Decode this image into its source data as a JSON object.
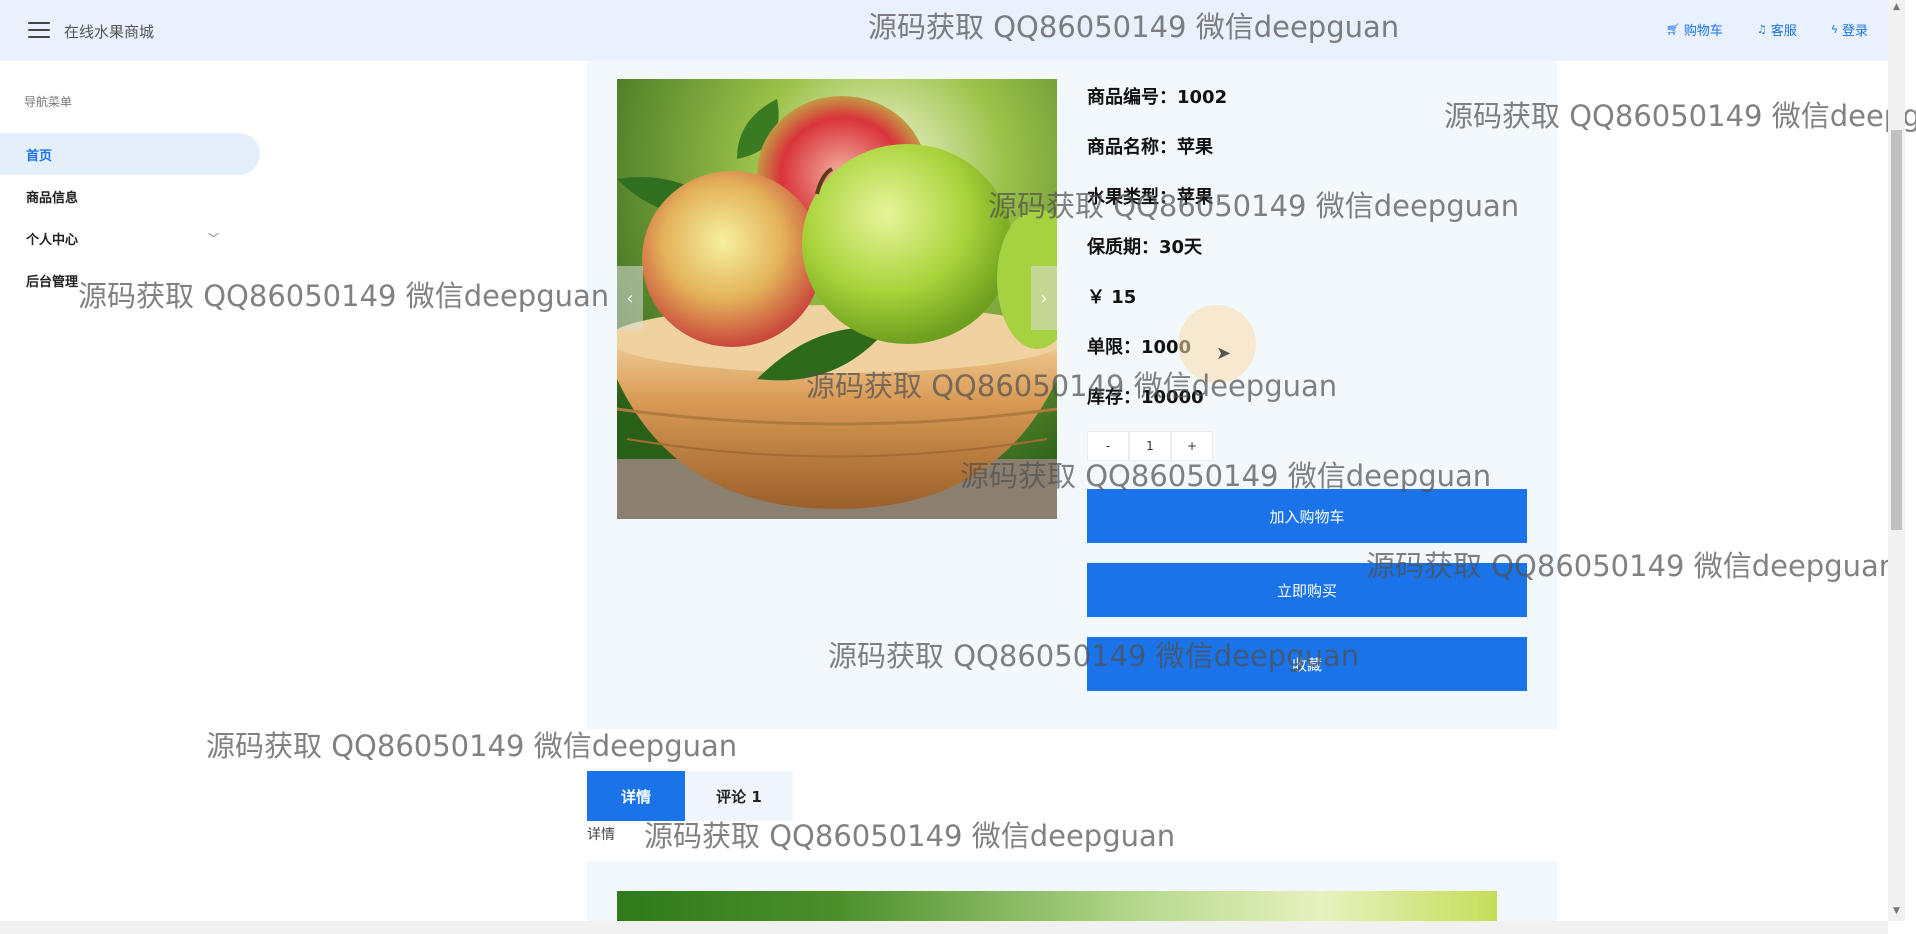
{
  "header": {
    "site_title": "在线水果商城",
    "links": [
      {
        "icon": "cart-icon",
        "label": "购物车"
      },
      {
        "icon": "bell-icon",
        "label": "客服"
      },
      {
        "icon": "lightning-icon",
        "label": "登录"
      }
    ]
  },
  "sidebar": {
    "title": "导航菜单",
    "items": [
      {
        "label": "首页",
        "active": true
      },
      {
        "label": "商品信息"
      },
      {
        "label": "个人中心",
        "has_submenu": true
      },
      {
        "label": "后台管理"
      }
    ]
  },
  "product": {
    "image": "apples-in-wooden-bowl",
    "rows": [
      "商品编号：1002",
      "商品名称：苹果",
      "水果类型：苹果",
      "保质期：30天",
      "￥ 15",
      "单限：1000",
      "库存：10000"
    ],
    "stepper": {
      "minus": "-",
      "value": "1",
      "plus": "+"
    },
    "buttons": {
      "add_to_cart": "加入购物车",
      "buy_now": "立即购买",
      "favorite": "收藏"
    },
    "carousel": {
      "prev": "‹",
      "next": "›"
    }
  },
  "tabs": [
    {
      "label": "详情",
      "active": true
    },
    {
      "label": "评论 1"
    }
  ],
  "detail_label": "详情",
  "watermark": "源码获取 QQ86050149 微信deepguan",
  "colors": {
    "accent": "#1a73e8",
    "header_bg": "#e8f1fc",
    "panel_bg": "#f3f8fd"
  }
}
